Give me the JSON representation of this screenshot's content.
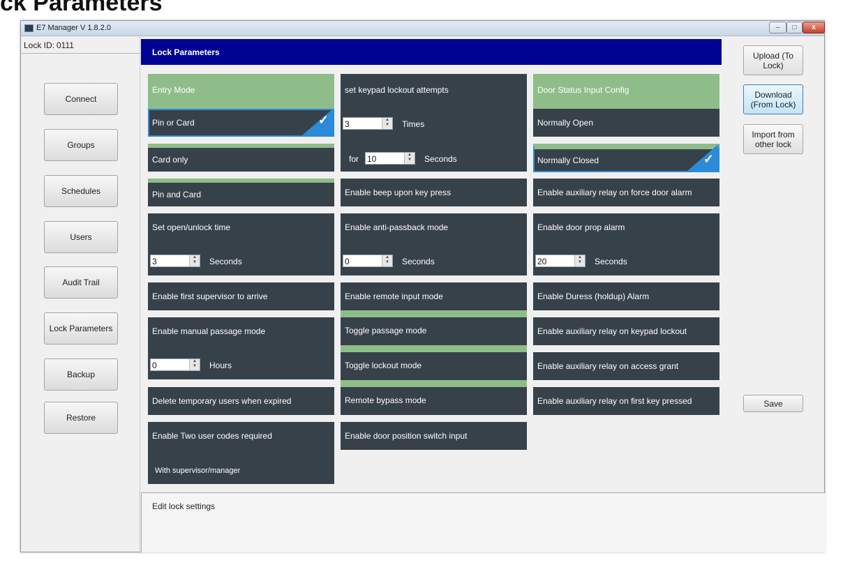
{
  "page_heading": "ck Parameters",
  "window": {
    "title": "E7 Manager V 1.8.2.0",
    "min": "–",
    "max": "□",
    "close": "x"
  },
  "lock": {
    "label": "Lock ID:",
    "value": "0111"
  },
  "nav": [
    "Connect",
    "Groups",
    "Schedules",
    "Users",
    "Audit Trail",
    "Lock Parameters",
    "Backup",
    "Restore"
  ],
  "header": {
    "title": "Lock Parameters"
  },
  "col1": {
    "entry_mode": "Entry Mode",
    "pin_or_card": "Pin or Card",
    "card_only": "Card only",
    "pin_and_card": "Pin and Card",
    "open_time": "Set open/unlock time",
    "open_time_value": "3",
    "open_time_unit": "Seconds",
    "first_supervisor": "Enable first supervisor to arrive",
    "manual_passage": "Enable manual passage mode",
    "manual_passage_value": "0",
    "manual_passage_unit": "Hours",
    "delete_temp": "Delete temporary users when expired",
    "two_codes": "Enable Two user codes required",
    "two_codes_sub": "With supervisor/manager"
  },
  "col2": {
    "keypad_lockout": "set keypad lockout attempts",
    "attempts_value": "3",
    "attempts_unit": "Times",
    "for_label": "for",
    "for_value": "10",
    "for_unit": "Seconds",
    "beep": "Enable beep upon key press",
    "anti_passback": "Enable anti-passback mode",
    "anti_passback_value": "0",
    "anti_passback_unit": "Seconds",
    "remote_input": "Enable remote input mode",
    "toggle_passage": "Toggle passage mode",
    "toggle_lockout": "Toggle lockout mode",
    "remote_bypass": "Remote bypass mode",
    "door_switch": "Enable door position switch input"
  },
  "col3": {
    "door_status": "Door Status Input Config",
    "normally_open": "Normally Open",
    "normally_closed": "Normally Closed",
    "aux_force": "Enable auxiliary relay on force door alarm",
    "door_prop": "Enable door prop alarm",
    "door_prop_value": "20",
    "door_prop_unit": "Seconds",
    "duress": "Enable Duress (holdup) Alarm",
    "aux_keypad": "Enable auxiliary relay on keypad lockout",
    "aux_grant": "Enable auxiliary relay on access grant",
    "aux_first_key": "Enable auxiliary relay on first key pressed"
  },
  "right": {
    "upload": "Upload (To Lock)",
    "download": "Download (From Lock)",
    "import": "Import from other lock",
    "save": "Save"
  },
  "status": {
    "text": "Edit lock settings"
  },
  "icons": {
    "check": "checkmark-icon",
    "spin": "spinner-arrows-icon"
  },
  "colors": {
    "header": "#000391",
    "tile": "#37414a",
    "tile_active": "#8fbd8a",
    "selected": "#2b8bd8"
  }
}
